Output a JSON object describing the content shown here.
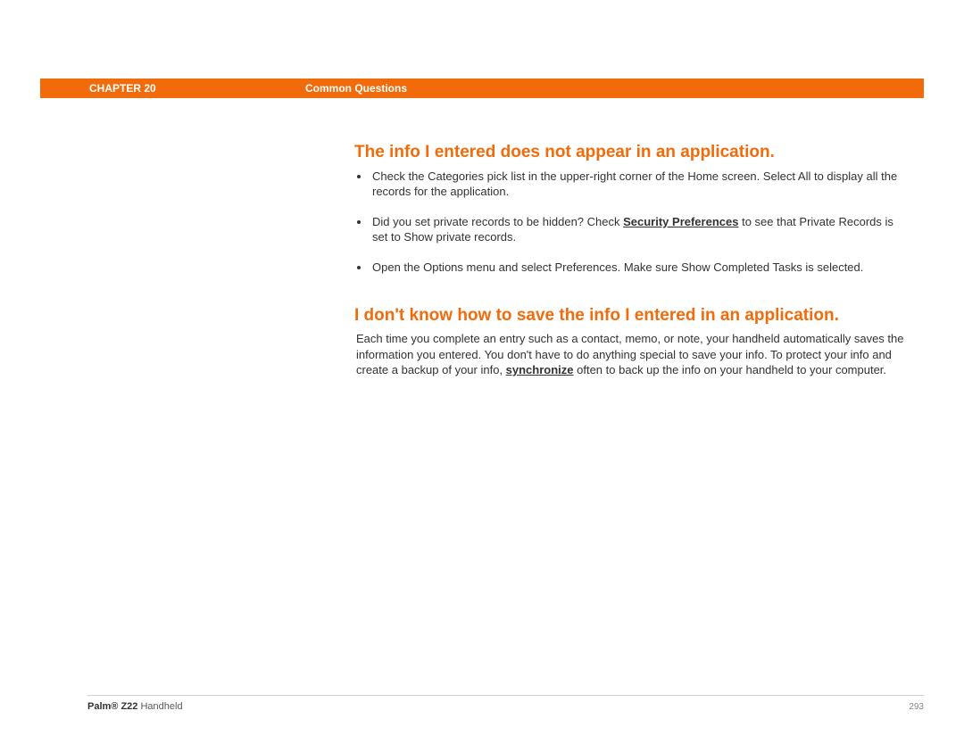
{
  "header": {
    "chapter_label": "CHAPTER 20",
    "title": "Common Questions"
  },
  "sections": [
    {
      "heading": "The info I entered does not appear in an application.",
      "bullets": [
        {
          "pre": "Check the Categories pick list in the upper-right corner of the Home screen. Select All to display all the records for the application.",
          "link": "",
          "post": ""
        },
        {
          "pre": "Did you set private records to be hidden? Check ",
          "link": "Security Preferences",
          "post": " to see that Private Records is set to Show private records."
        },
        {
          "pre": "Open the Options menu and select Preferences. Make sure Show Completed Tasks is selected.",
          "link": "",
          "post": ""
        }
      ]
    },
    {
      "heading": "I don't know how to save the info I entered in an application.",
      "para": {
        "pre": "Each time you complete an entry such as a contact, memo, or note, your handheld automatically saves the information you entered. You don't have to do anything special to save your info. To protect your info and create a backup of your info, ",
        "link": "synchronize",
        "post": " often to back up the info on your handheld to your computer."
      }
    }
  ],
  "footer": {
    "product_strong": "Palm® Z22",
    "product_rest": " Handheld",
    "page": "293"
  }
}
